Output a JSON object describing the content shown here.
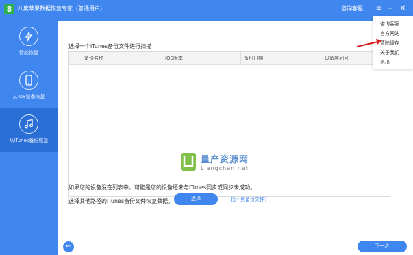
{
  "app": {
    "logo_text": "8",
    "title": "八度苹果数据恢复专家（普通用户）",
    "support_link": "咨询客服",
    "window_controls": [
      "≡",
      "−",
      "✕"
    ]
  },
  "sidebar": {
    "items": [
      {
        "label": "智能恢复",
        "icon": "lightning-icon",
        "active": false
      },
      {
        "label": "从iOS设备恢复",
        "icon": "phone-icon",
        "active": false
      },
      {
        "label": "从iTunes备份恢复",
        "icon": "music-icon",
        "active": true
      }
    ]
  },
  "main": {
    "title": "选择一个iTunes备份文件进行扫描",
    "table": {
      "columns": [
        "备份名称",
        "iOS版本",
        "备份日期",
        "设备序列号"
      ],
      "rows": []
    },
    "watermark": {
      "cn": "量产资源网",
      "en": "Liangchan.net"
    },
    "hint": "如果您的设备没在列表中，可能是您的设备还未与iTunes同步或同步未成功。",
    "browse_label": "选择其他路径的iTunes备份文件恢复数据。",
    "select_button": "选择",
    "no_backup_link": "找不到备份文件？",
    "back_button": "←",
    "next_button": "下一步"
  },
  "menu": {
    "items": [
      "咨询客服",
      "官方网站",
      "清除缓存",
      "关于我们",
      "退出"
    ]
  },
  "colors": {
    "primary": "#3f86ef",
    "sidebar_active": "#2a6fd6",
    "logo_green": "#2fb24c",
    "annotation_red": "#d42020"
  }
}
